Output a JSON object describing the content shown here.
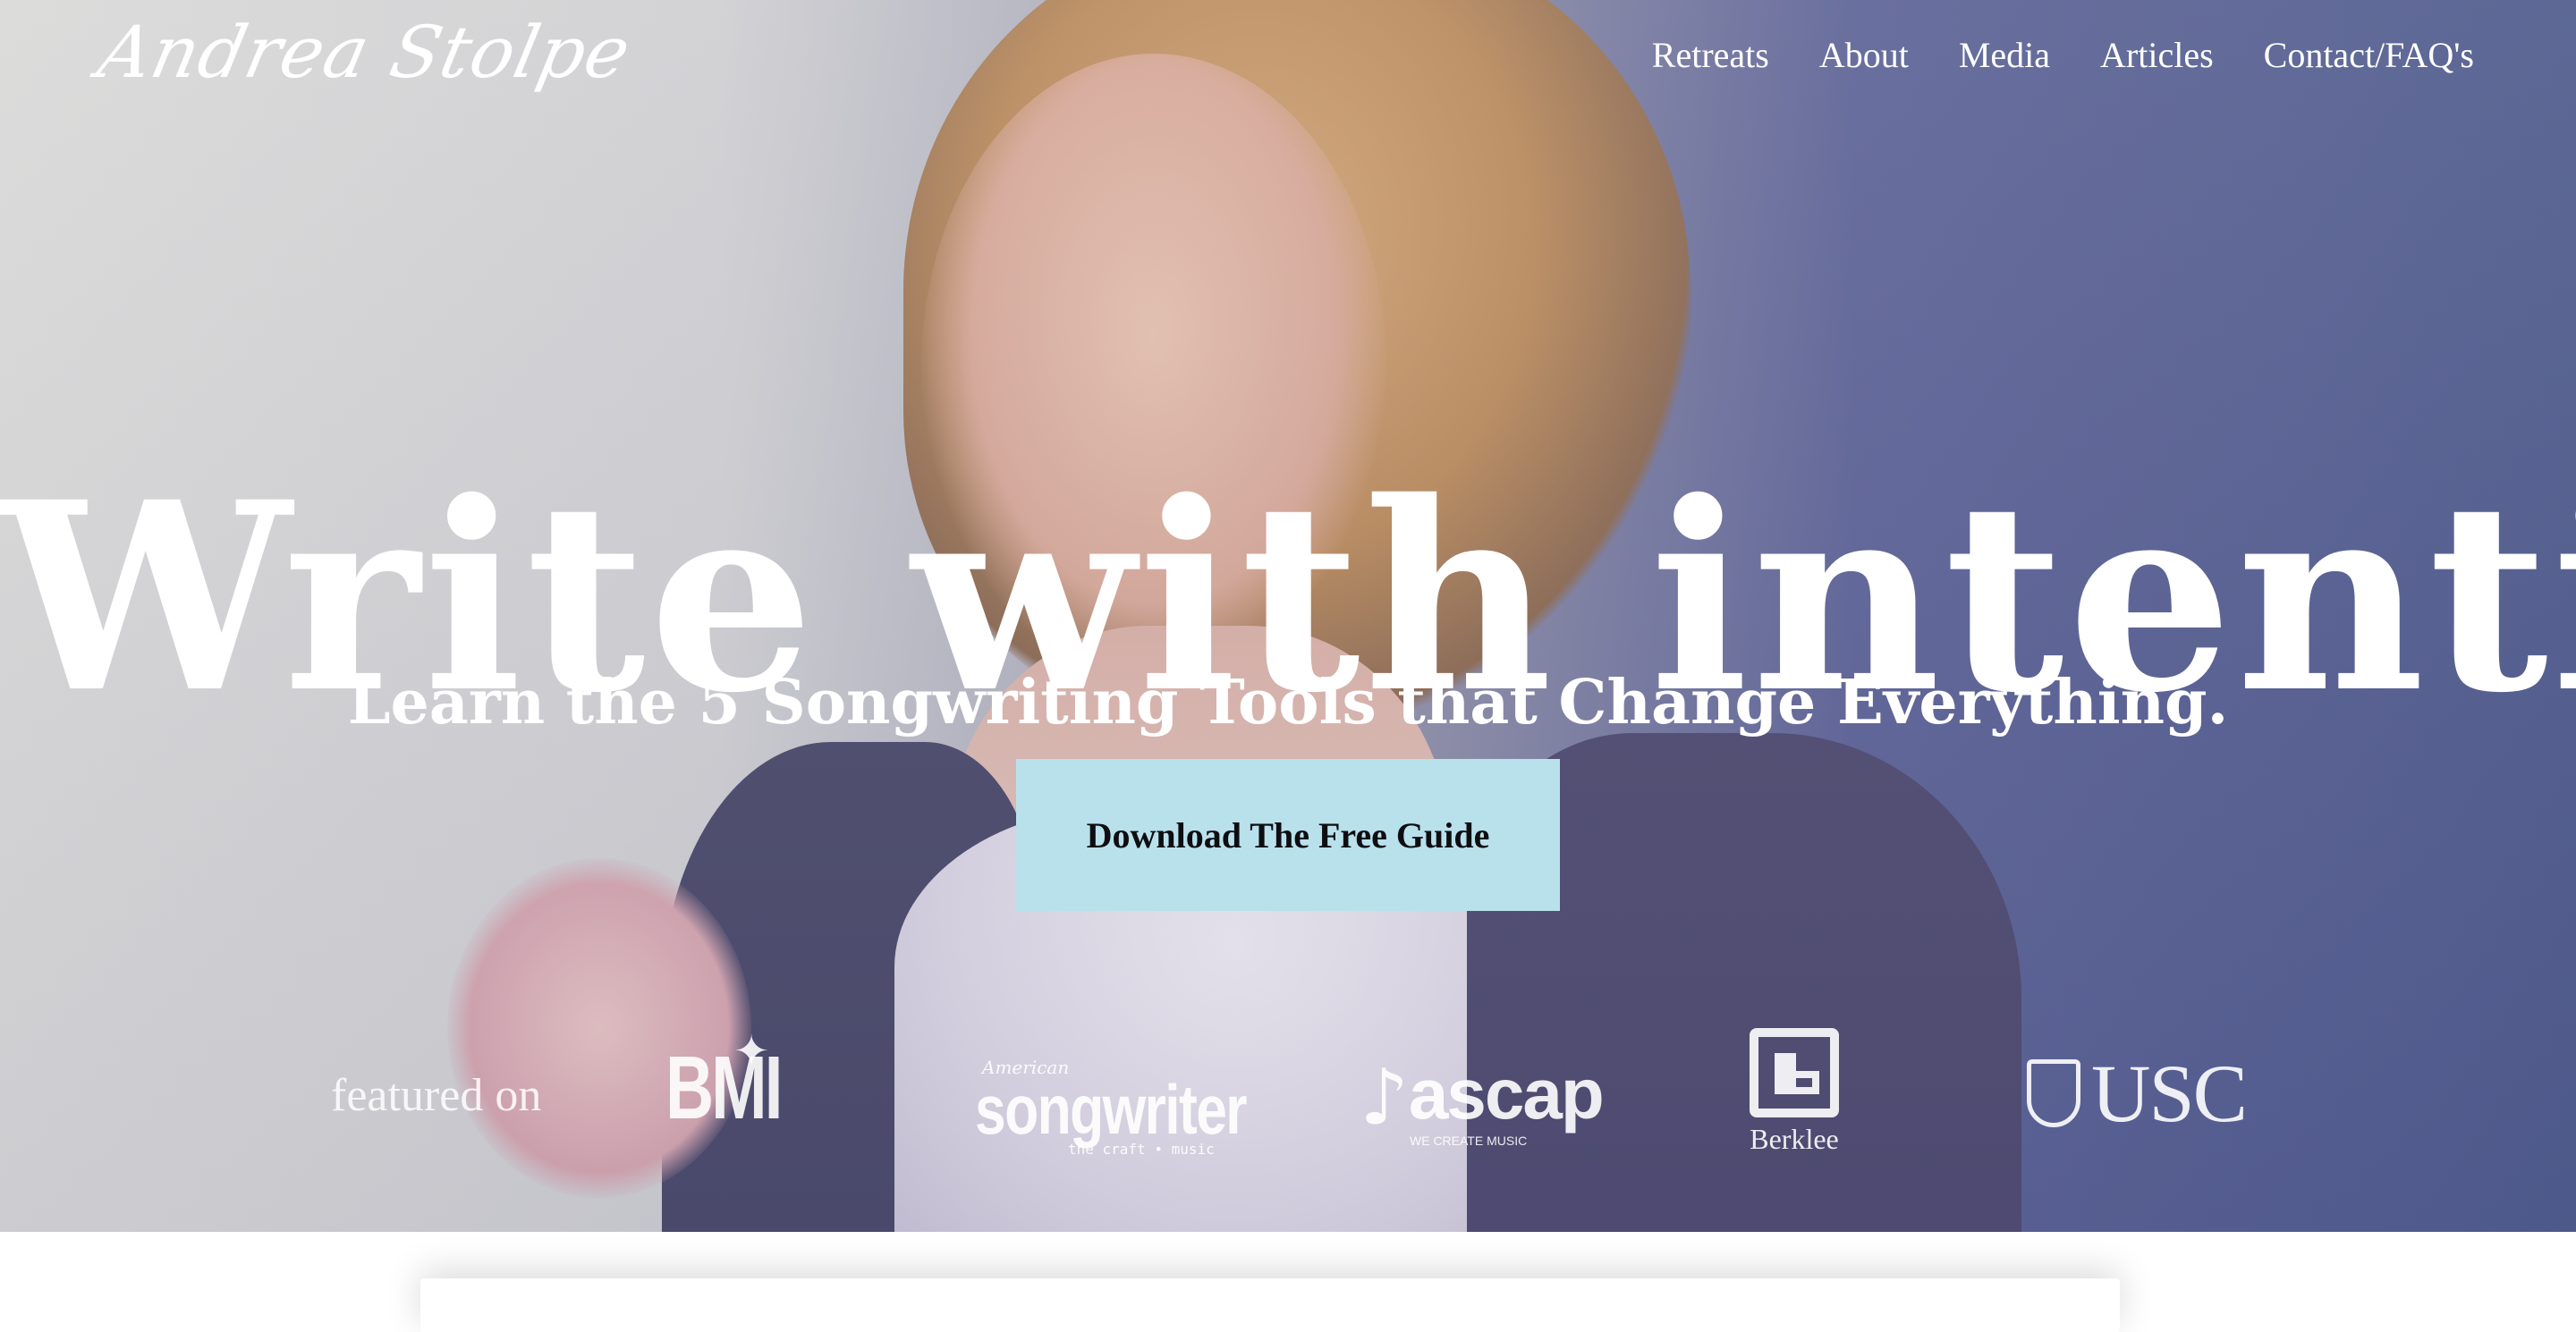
{
  "brand": {
    "name": "Andrea Stolpe"
  },
  "nav": {
    "items": [
      "Retreats",
      "About",
      "Media",
      "Articles",
      "Contact/FAQ's"
    ]
  },
  "hero": {
    "headline": "Write with intention.",
    "subheadline": "Learn the 5 Songwriting Tools that Change Everything.",
    "cta_label": "Download The Free Guide",
    "cta_color": "#b9e1ec"
  },
  "featured": {
    "label": "featured on",
    "logos": {
      "bmi": "BMI",
      "songwriter_top": "American",
      "songwriter_main": "songwriter",
      "songwriter_sub": "the craft • music",
      "ascap": "ascap",
      "ascap_tag": "WE CREATE MUSIC",
      "berklee": "Berklee",
      "usc": "USC"
    }
  }
}
